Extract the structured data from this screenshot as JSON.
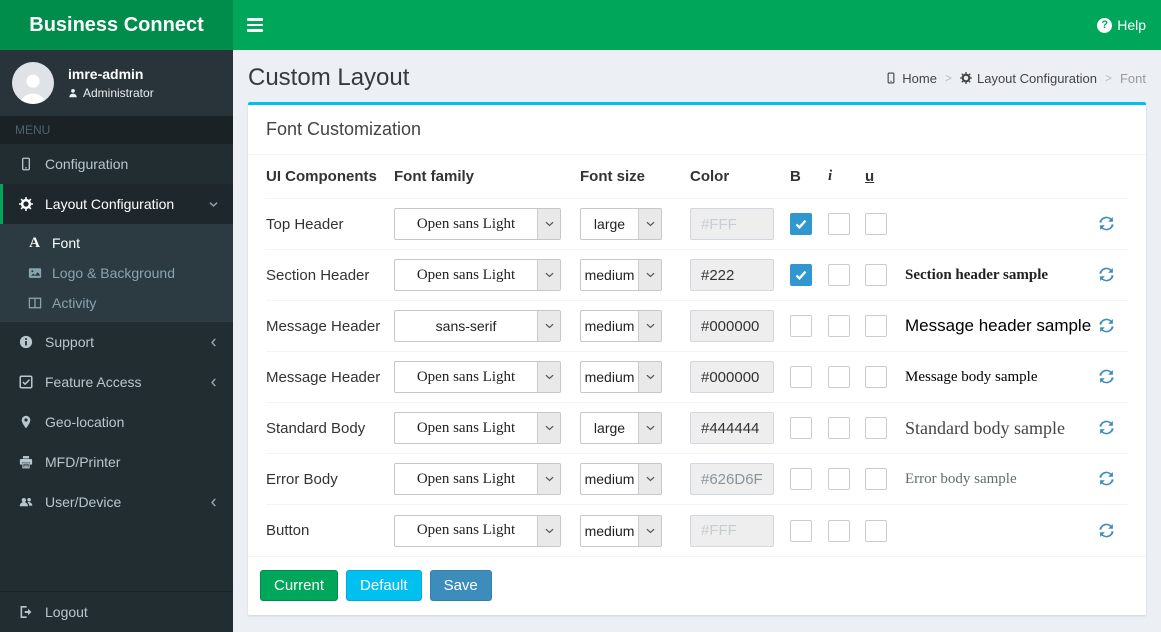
{
  "header": {
    "brand": "Business Connect",
    "help_label": "Help"
  },
  "icons": {
    "help_glyph": "?",
    "font_glyph": "A"
  },
  "sidebar": {
    "user": {
      "name": "imre-admin",
      "role": "Administrator"
    },
    "menu_label": "MENU",
    "items": [
      {
        "id": "configuration",
        "label": "Configuration"
      },
      {
        "id": "layout-configuration",
        "label": "Layout Configuration",
        "active": true,
        "children": [
          {
            "id": "font",
            "label": "Font",
            "active": true
          },
          {
            "id": "logo-background",
            "label": "Logo & Background"
          },
          {
            "id": "activity",
            "label": "Activity"
          }
        ]
      },
      {
        "id": "support",
        "label": "Support",
        "collapsible": true
      },
      {
        "id": "feature-access",
        "label": "Feature Access",
        "collapsible": true
      },
      {
        "id": "geo-location",
        "label": "Geo-location"
      },
      {
        "id": "mfd-printer",
        "label": "MFD/Printer"
      },
      {
        "id": "user-device",
        "label": "User/Device",
        "collapsible": true
      },
      {
        "id": "logout",
        "label": "Logout"
      }
    ]
  },
  "page": {
    "title": "Custom Layout",
    "breadcrumb": {
      "home": "Home",
      "section": "Layout Configuration",
      "current": "Font",
      "separator": ">"
    }
  },
  "panel": {
    "title": "Font Customization",
    "columns": {
      "component": "UI Components",
      "family": "Font family",
      "size": "Font size",
      "color": "Color",
      "bold": "B",
      "italic": "i",
      "underline": "u"
    },
    "rows": [
      {
        "component": "Top Header",
        "family": "Open sans Light",
        "size": "large",
        "color": "#FFF",
        "color_state": "disabled",
        "bold": true,
        "italic": false,
        "underline": false,
        "sample": ""
      },
      {
        "component": "Section Header",
        "family": "Open sans Light",
        "size": "medium",
        "color": "#222",
        "color_state": "normal",
        "bold": true,
        "italic": false,
        "underline": false,
        "sample": "Section header sample"
      },
      {
        "component": "Message Header",
        "family": "sans-serif",
        "size": "medium",
        "color": "#000000",
        "color_state": "normal",
        "bold": false,
        "italic": false,
        "underline": false,
        "sample": "Message header sample"
      },
      {
        "component": "Message Header",
        "family": "Open sans Light",
        "size": "medium",
        "color": "#000000",
        "color_state": "normal",
        "bold": false,
        "italic": false,
        "underline": false,
        "sample": "Message body sample"
      },
      {
        "component": "Standard Body",
        "family": "Open sans Light",
        "size": "large",
        "color": "#444444",
        "color_state": "normal",
        "bold": false,
        "italic": false,
        "underline": false,
        "sample": "Standard body sample"
      },
      {
        "component": "Error Body",
        "family": "Open sans Light",
        "size": "medium",
        "color": "#626D6F",
        "color_state": "muted",
        "bold": false,
        "italic": false,
        "underline": false,
        "sample": "Error body sample"
      },
      {
        "component": "Button",
        "family": "Open sans Light",
        "size": "medium",
        "color": "#FFF",
        "color_state": "disabled",
        "bold": false,
        "italic": false,
        "underline": false,
        "sample": ""
      }
    ],
    "buttons": [
      {
        "label": "Current"
      },
      {
        "label": "Default"
      },
      {
        "label": "Save"
      }
    ]
  },
  "colors": {
    "brand_bg": "#008d4c",
    "navbar_bg": "#00a65a",
    "sidebar_bg": "#222d32",
    "submenu_bg": "#2c3b41",
    "content_bg": "#ecf0f5",
    "box_top_border": "#00c0ef",
    "checkbox_checked": "#3097d1",
    "refresh_icon": "#3c8dbc",
    "button_current": "#00a65a",
    "button_default": "#00c0ef",
    "button_save": "#3c8dbc"
  }
}
